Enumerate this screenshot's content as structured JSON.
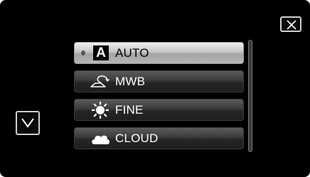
{
  "dialog": {
    "close_icon": "close-x-icon",
    "scroll_down_icon": "chevron-down-icon"
  },
  "white_balance_menu": {
    "items": [
      {
        "label": "AUTO",
        "icon": "auto-a-icon",
        "icon_glyph": "A",
        "selected": true
      },
      {
        "label": "MWB",
        "icon": "manual-white-balance-icon",
        "selected": false
      },
      {
        "label": "FINE",
        "icon": "sun-icon",
        "selected": false
      },
      {
        "label": "CLOUD",
        "icon": "cloud-icon",
        "selected": false
      }
    ]
  },
  "colors": {
    "screen_background": "#000000",
    "selected_item": "#d0d0d0",
    "unselected_item": "#3a3a3a",
    "button_border": "#cfcfcf"
  }
}
